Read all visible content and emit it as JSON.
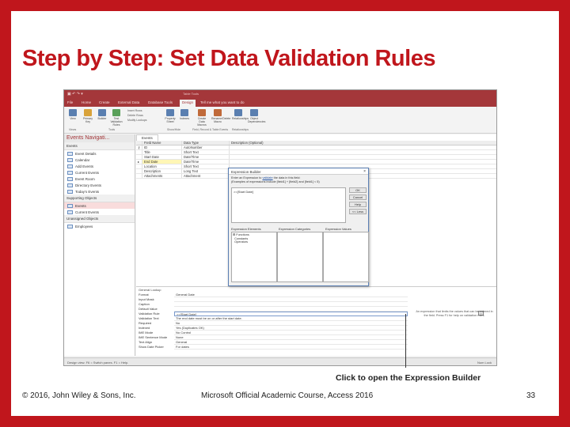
{
  "slide": {
    "title": "Step by Step: Set Data Validation Rules",
    "callout": "Click to open the Expression Builder",
    "footer_left": "© 2016, John Wiley & Sons, Inc.",
    "footer_center": "Microsoft Official Academic Course, Access 2016",
    "page_number": "33"
  },
  "access": {
    "titlebar": "Table Tools",
    "ribbon_tabs": [
      "File",
      "Home",
      "Create",
      "External Data",
      "Database Tools",
      "Design",
      "Tell me what you want to do"
    ],
    "ribbon_buttons": [
      "View",
      "Primary Key",
      "Builder",
      "Test Validation Rules",
      "Property Sheet",
      "Indexes",
      "Create Data Macros",
      "Rename/Delete Macro",
      "Relationships",
      "Object Dependencies"
    ],
    "ribbon_small": [
      "Insert Rows",
      "Delete Rows",
      "Modify Lookups"
    ],
    "ribbon_groups": [
      "Views",
      "Tools",
      "Show/Hide",
      "Field, Record & Table Events",
      "Relationships"
    ],
    "nav": {
      "header": "Events Navigati...",
      "groups": [
        {
          "label": "Events",
          "items": [
            "Event Details",
            "Calendar",
            "Add Events",
            "Current Events",
            "Event Room",
            "Directory Events",
            "Today's Events"
          ]
        },
        {
          "label": "Supporting Objects",
          "items": [
            "Events",
            "Current Events"
          ]
        },
        {
          "label": "Unassigned Objects",
          "items": [
            "Employees"
          ]
        }
      ]
    },
    "doc_tab": "Events",
    "grid": {
      "headers": [
        "Field Name",
        "Data Type",
        "Description (Optional)"
      ],
      "rows": [
        {
          "field": "ID",
          "type": "AutoNumber"
        },
        {
          "field": "Title",
          "type": "Short Text"
        },
        {
          "field": "Start Date",
          "type": "Date/Time"
        },
        {
          "field": "End Date",
          "type": "Date/Time"
        },
        {
          "field": "Location",
          "type": "Short Text"
        },
        {
          "field": "Description",
          "type": "Long Text"
        },
        {
          "field": "Attachments",
          "type": "Attachment"
        }
      ]
    },
    "expression_builder": {
      "title": "Expression Builder",
      "instructions_1": "Enter an Expression to",
      "instructions_link": "validate",
      "instructions_2": "the data in this field:",
      "examples": "(Examples of expressions include [field1] + [field2] and [field1] < 5)",
      "expression": ">=[Start Date]",
      "buttons": [
        "OK",
        "Cancel",
        "Help",
        "<< Less"
      ],
      "col_headers": [
        "Expression Elements",
        "Expression Categories",
        "Expression Values"
      ],
      "elements": [
        "Functions",
        "Constants",
        "Operators"
      ]
    },
    "properties": {
      "tabs": "General   Lookup",
      "rows": [
        {
          "name": "Format",
          "value": "General Date"
        },
        {
          "name": "Input Mask",
          "value": ""
        },
        {
          "name": "Caption",
          "value": ""
        },
        {
          "name": "Default Value",
          "value": ""
        },
        {
          "name": "Validation Rule",
          "value": ">=[Start Date]"
        },
        {
          "name": "Validation Text",
          "value": "The end date must be on or after the start date."
        },
        {
          "name": "Required",
          "value": "No"
        },
        {
          "name": "Indexed",
          "value": "Yes (Duplicates OK)"
        },
        {
          "name": "IME Mode",
          "value": "No Control"
        },
        {
          "name": "IME Sentence Mode",
          "value": "None"
        },
        {
          "name": "Text Align",
          "value": "General"
        },
        {
          "name": "Show Date Picker",
          "value": "For dates"
        }
      ],
      "help": "An expression that limits the values that can be entered in the field. Press F1 for help on validation rules."
    },
    "status_left": "Design view.  F6 = Switch panes.  F1 = Help.",
    "status_right": "Num Lock"
  },
  "colors": {
    "brand": "#c0161c",
    "access": "#a4373a"
  }
}
